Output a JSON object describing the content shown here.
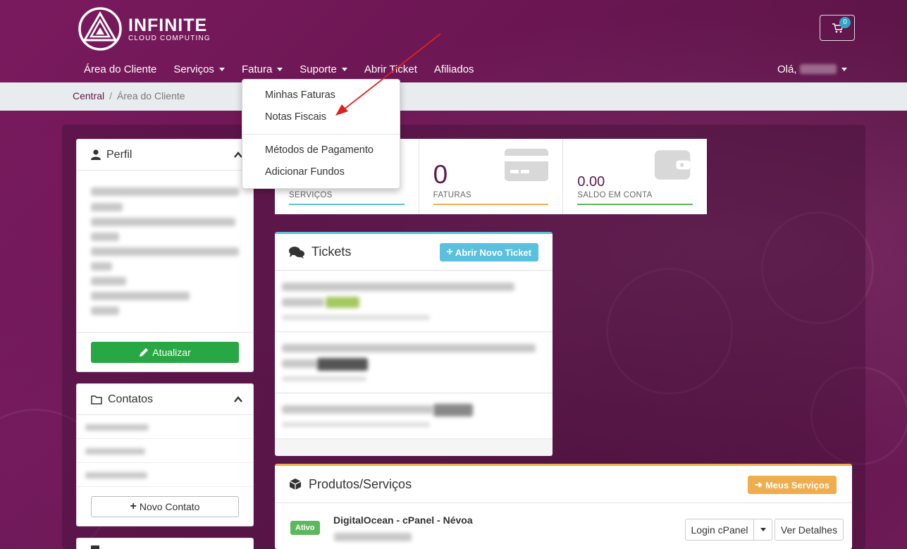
{
  "brand": {
    "name": "INFINITE",
    "tagline": "CLOUD COMPUTING"
  },
  "cart": {
    "count": "0"
  },
  "nav": {
    "items": [
      {
        "label": "Área do Cliente"
      },
      {
        "label": "Serviços"
      },
      {
        "label": "Fatura"
      },
      {
        "label": "Suporte"
      },
      {
        "label": "Abrir Ticket"
      },
      {
        "label": "Afiliados"
      }
    ],
    "greeting": "Olá,"
  },
  "breadcrumb": {
    "home": "Central",
    "current": "Área do Cliente"
  },
  "fatura_menu": {
    "items": [
      {
        "label": "Minhas Faturas"
      },
      {
        "label": "Notas Fiscais"
      },
      {
        "label": "Métodos de Pagamento"
      },
      {
        "label": "Adicionar Fundos"
      }
    ]
  },
  "perfil": {
    "title": "Perfil",
    "update_label": "Atualizar"
  },
  "contatos": {
    "title": "Contatos",
    "new_label": "Novo Contato"
  },
  "stats": {
    "servicos_label": "SERVIÇOS",
    "faturas_value": "0",
    "faturas_label": "FATURAS",
    "saldo_value": "0.00",
    "saldo_label": "SALDO EM CONTA"
  },
  "tickets": {
    "title": "Tickets",
    "new_label": "Abrir Novo Ticket"
  },
  "produtos": {
    "title": "Produtos/Serviços",
    "my_services_label": "Meus Serviços",
    "item_name": "DigitalOcean - cPanel - Névoa",
    "status": "Ativo",
    "login_label": "Login cPanel",
    "details_label": "Ver Detalhes"
  },
  "colors": {
    "brand": "#5c1a4d",
    "info": "#5bc0de",
    "warning": "#f0ad4e",
    "success": "#28a745"
  }
}
